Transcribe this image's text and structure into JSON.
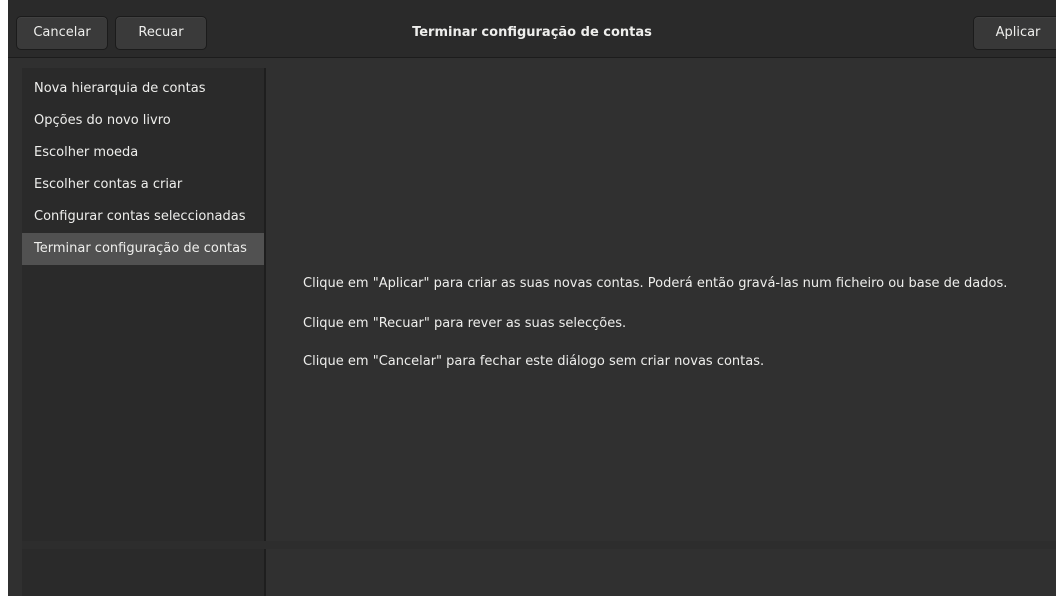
{
  "header": {
    "cancel_label": "Cancelar",
    "back_label": "Recuar",
    "title": "Terminar configuração de contas",
    "apply_label": "Aplicar"
  },
  "sidebar": {
    "items": [
      {
        "label": "Nova hierarquia de contas"
      },
      {
        "label": "Opções do novo livro"
      },
      {
        "label": "Escolher moeda"
      },
      {
        "label": "Escolher contas a criar"
      },
      {
        "label": "Configurar contas seleccionadas"
      },
      {
        "label": "Terminar configuração de contas"
      }
    ],
    "selected_index": 5
  },
  "main": {
    "messages": [
      "Clique em \"Aplicar\" para criar as suas novas contas. Poderá então gravá-las num ficheiro ou base de dados.",
      "Clique em \"Recuar\" para rever as suas selecções.",
      "Clique em \"Cancelar\" para fechar este diálogo sem criar novas contas."
    ]
  },
  "colors": {
    "window_bg": "#303030",
    "header_bg": "#2a2a2a",
    "sidebar_bg": "#2a2a2a",
    "selected_bg": "#515151",
    "text": "#eeeeec"
  }
}
